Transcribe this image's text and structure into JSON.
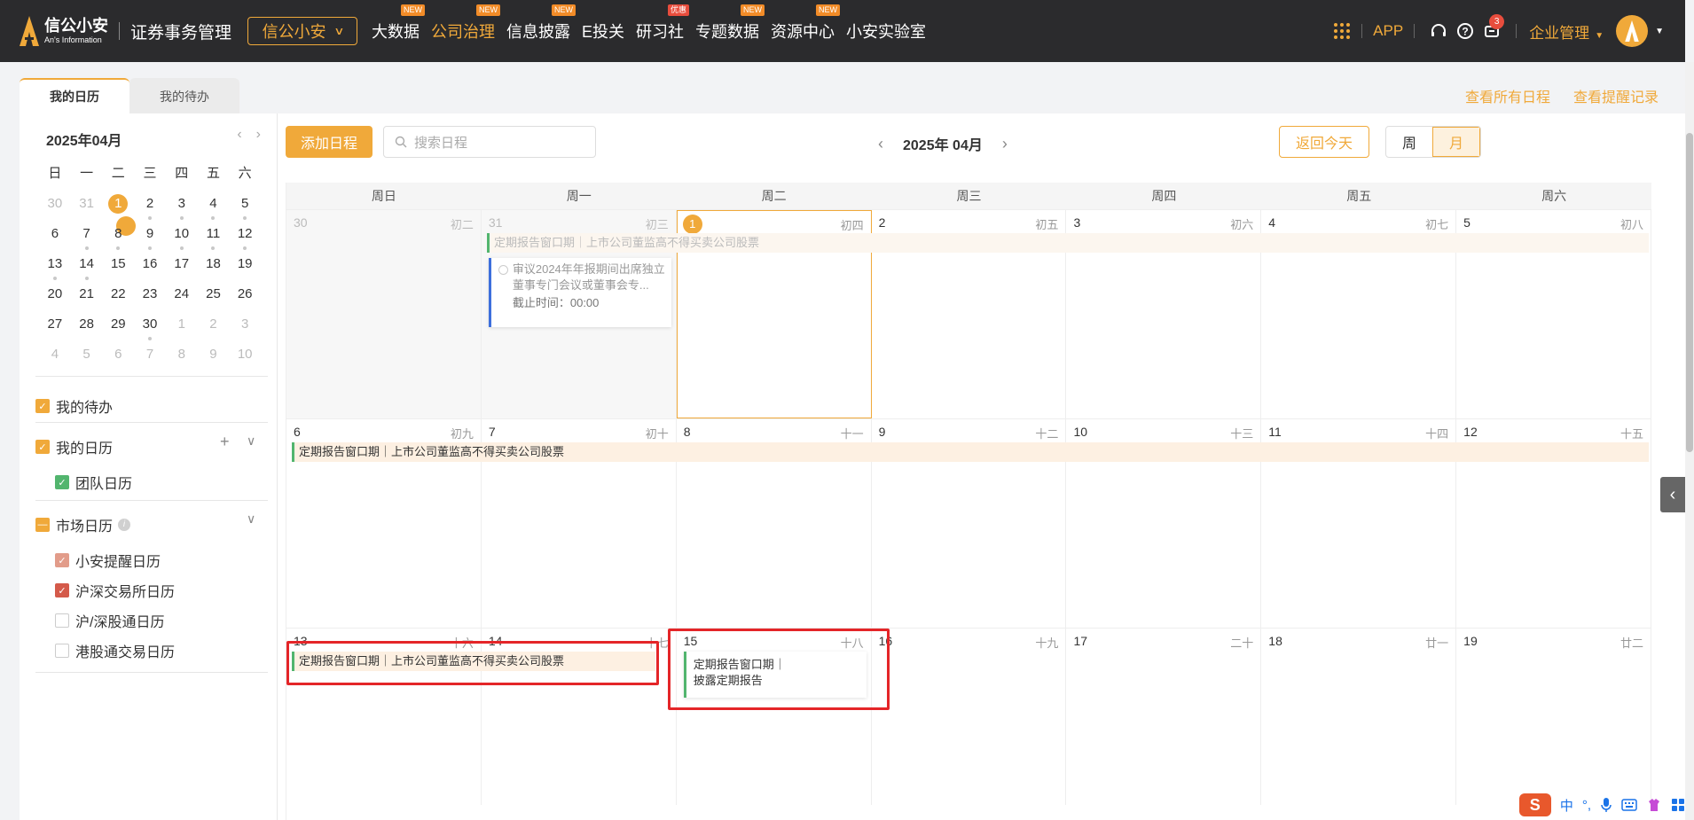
{
  "topbar": {
    "logo_cn": "信公小安",
    "logo_en": "An's Information",
    "system_title": "证券事务管理",
    "brand_select": "信公小安",
    "nav": [
      {
        "label": "大数据",
        "badge": "NEW",
        "badge_color": "#f28c28"
      },
      {
        "label": "公司治理",
        "badge": "NEW",
        "badge_color": "#f28c28",
        "active": true
      },
      {
        "label": "信息披露",
        "badge": "NEW",
        "badge_color": "#f28c28"
      },
      {
        "label": "E投关",
        "badge": "",
        "badge_color": ""
      },
      {
        "label": "研习社",
        "badge": "优惠",
        "badge_color": "#e84d3d"
      },
      {
        "label": "专题数据",
        "badge": "NEW",
        "badge_color": "#f28c28"
      },
      {
        "label": "资源中心",
        "badge": "NEW",
        "badge_color": "#f28c28"
      },
      {
        "label": "小安实验室",
        "badge": "",
        "badge_color": ""
      }
    ],
    "app_label": "APP",
    "message_count": "3",
    "enterprise_label": "企业管理"
  },
  "tabs": {
    "calendar": "我的日历",
    "todo": "我的待办"
  },
  "links": {
    "all_schedules": "查看所有日程",
    "reminder_records": "查看提醒记录"
  },
  "mini_calendar": {
    "title": "2025年04月",
    "weekdays": [
      "日",
      "一",
      "二",
      "三",
      "四",
      "五",
      "六"
    ],
    "rows": [
      [
        "30",
        "31",
        "1",
        "2",
        "3",
        "4",
        "5"
      ],
      [
        "6",
        "7",
        "8",
        "9",
        "10",
        "11",
        "12"
      ],
      [
        "13",
        "14",
        "15",
        "16",
        "17",
        "18",
        "19"
      ],
      [
        "20",
        "21",
        "22",
        "23",
        "24",
        "25",
        "26"
      ],
      [
        "27",
        "28",
        "29",
        "30",
        "1",
        "2",
        "3"
      ],
      [
        "4",
        "5",
        "6",
        "7",
        "8",
        "9",
        "10"
      ]
    ]
  },
  "sidebar": {
    "my_todo": "我的待办",
    "my_calendar": "我的日历",
    "team_calendar": "团队日历",
    "market_calendar": "市场日历",
    "market_items": [
      "小安提醒日历",
      "沪深交易所日历",
      "沪/深股通日历",
      "港股通交易日历"
    ]
  },
  "toolbar": {
    "add_button": "添加日程",
    "search_placeholder": "搜索日程",
    "month_title": "2025年 04月",
    "today_button": "返回今天",
    "view_week": "周",
    "view_month": "月"
  },
  "calendar": {
    "weekday_headers": [
      "周日",
      "周一",
      "周二",
      "周三",
      "周四",
      "周五",
      "周六"
    ],
    "weeks": [
      [
        {
          "d": "30",
          "l": "初二"
        },
        {
          "d": "31",
          "l": "初三"
        },
        {
          "d": "1",
          "l": "初四"
        },
        {
          "d": "2",
          "l": "初五"
        },
        {
          "d": "3",
          "l": "初六"
        },
        {
          "d": "4",
          "l": "初七"
        },
        {
          "d": "5",
          "l": "初八"
        }
      ],
      [
        {
          "d": "6",
          "l": "初九"
        },
        {
          "d": "7",
          "l": "初十"
        },
        {
          "d": "8",
          "l": "十一"
        },
        {
          "d": "9",
          "l": "十二"
        },
        {
          "d": "10",
          "l": "十三"
        },
        {
          "d": "11",
          "l": "十四"
        },
        {
          "d": "12",
          "l": "十五"
        }
      ],
      [
        {
          "d": "13",
          "l": "十六"
        },
        {
          "d": "14",
          "l": "十七"
        },
        {
          "d": "15",
          "l": "十八"
        },
        {
          "d": "16",
          "l": "十九"
        },
        {
          "d": "17",
          "l": "二十"
        },
        {
          "d": "18",
          "l": "廿一"
        },
        {
          "d": "19",
          "l": "廿二"
        }
      ]
    ],
    "event_window": "定期报告窗口期｜上市公司董监高不得买卖公司股票",
    "todo_title": "审议2024年年报期间出席独立董事专门会议或董事会专...",
    "todo_deadline": "截止时间：00:00",
    "event_card_line1": "定期报告窗口期｜",
    "event_card_line2": "披露定期报告"
  },
  "ime": {
    "logo": "S",
    "lang": "中"
  },
  "colors": {
    "accent": "#f0a93a",
    "topbar": "#2b2b2d",
    "highlight": "#e42528"
  }
}
